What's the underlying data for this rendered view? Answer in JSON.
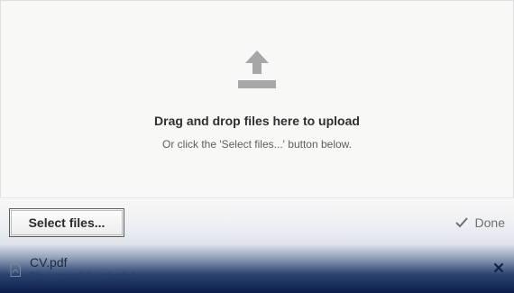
{
  "dropzone": {
    "title": "Drag and drop files here to upload",
    "subtitle": "Or click the 'Select files...' button below.",
    "icon": "upload-icon"
  },
  "toolbar": {
    "select_label": "Select files...",
    "done_label": "Done",
    "done_icon": "checkmark-icon"
  },
  "files": [
    {
      "name": "CV.pdf",
      "status": "File successfully uploaded",
      "icon": "pdf-file-icon",
      "remove_icon": "close-icon"
    }
  ],
  "colors": {
    "icon_gray": "#a7a7a7",
    "text_dark": "#303030",
    "file_row_dark": "#0b1d4c"
  }
}
